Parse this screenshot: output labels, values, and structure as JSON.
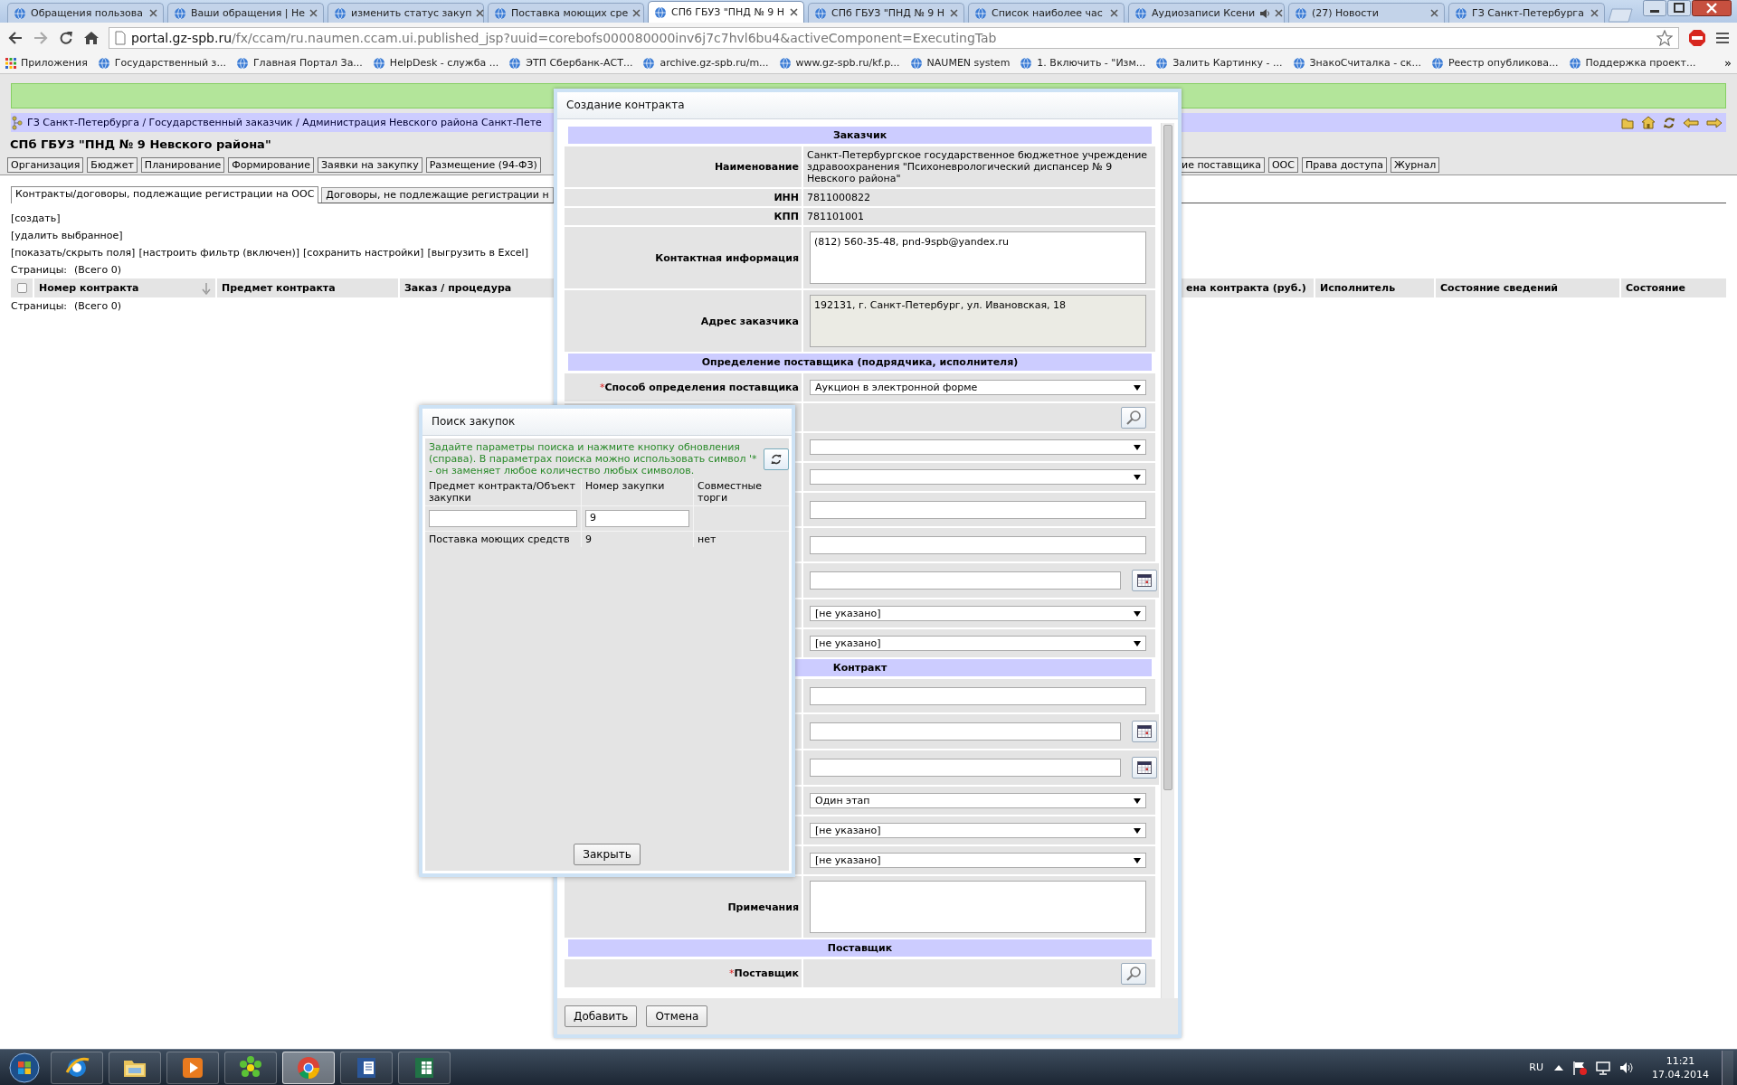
{
  "browser": {
    "tabs": [
      {
        "title": "Обращения пользова",
        "selected": false,
        "audio": false
      },
      {
        "title": "Ваши обращения | Не",
        "selected": false,
        "audio": false
      },
      {
        "title": "изменить статус закуп",
        "selected": false,
        "audio": false
      },
      {
        "title": "Поставка моющих сре",
        "selected": false,
        "audio": false
      },
      {
        "title": "СПб ГБУЗ \"ПНД № 9 Н",
        "selected": true,
        "audio": false
      },
      {
        "title": "СПб ГБУЗ \"ПНД № 9 Н",
        "selected": false,
        "audio": false
      },
      {
        "title": "Список наиболее час",
        "selected": false,
        "audio": false
      },
      {
        "title": "Аудиозаписи Ксени",
        "selected": false,
        "audio": true
      },
      {
        "title": "(27) Новости",
        "selected": false,
        "audio": false
      },
      {
        "title": "ГЗ Санкт-Петербурга",
        "selected": false,
        "audio": false
      }
    ],
    "address": {
      "host": "portal.gz-spb.ru",
      "path": "/fx/ccam/ru.naumen.ccam.ui.published_jsp?uuid=corebofs000080000inv6j7c7hvl6bu4&activeComponent=ExecutingTab"
    },
    "apps_label": "Приложения",
    "bookmarks": [
      "Государственный з...",
      "Главная Портал За...",
      "HelpDesk - служба ...",
      "ЭТП Сбербанк-АСТ...",
      "archive.gz-spb.ru/m...",
      "www.gz-spb.ru/kf.p...",
      "NAUMEN system",
      "1. Включить - \"Изм...",
      "Залить Картинку - ...",
      "ЗнакоСчиталка - ск...",
      "Реестр опубликова...",
      "Поддержка проект..."
    ],
    "bookmarks_more": "»"
  },
  "page": {
    "breadcrumb": "ГЗ Санкт-Петербурга / Государственный заказчик / Администрация Невского района Санкт-Пете",
    "title": "СПб ГБУЗ \"ПНД № 9 Невского района\"",
    "nav_left": [
      "Организация",
      "Бюджет",
      "Планирование",
      "Формирование",
      "Заявки на закупку",
      "Размещение (94-ФЗ)"
    ],
    "nav_right": [
      "ие поставщика",
      "ООС",
      "Права доступа",
      "Журнал"
    ],
    "subtabs": [
      {
        "label": "Контракты/договоры, подлежащие регистрации на ООС",
        "selected": true
      },
      {
        "label": "Договоры, не подлежащие регистрации н",
        "selected": false
      }
    ],
    "actions": [
      [
        "[создать]"
      ],
      [
        "[удалить выбранное]"
      ],
      [
        "[показать/скрыть поля]",
        "[настроить фильтр (включен)]",
        "[сохранить настройки]",
        "[выгрузить в Excel]"
      ]
    ],
    "pager_top": {
      "label": "Страницы:",
      "total": "(Всего 0)"
    },
    "select_all_checked": false,
    "columns_left": [
      "Номер контракта",
      "Предмет контракта",
      "Заказ / процедура"
    ],
    "columns_right": [
      "ена контракта (руб.)",
      "Исполнитель",
      "Состояние сведений",
      "Состояние"
    ],
    "pager_bottom": {
      "label": "Страницы:",
      "total": "(Всего 0)"
    }
  },
  "contract_dialog": {
    "title": "Создание контракта",
    "required_mark": "*",
    "sections": [
      {
        "heading": "Заказчик",
        "rows": [
          {
            "kind": "text",
            "label": "Наименование",
            "required": false,
            "value": "Санкт-Петербургское государственное бюджетное учреждение здравоохранения \"Психоневрологический диспансер № 9 Невского района\""
          },
          {
            "kind": "text",
            "label": "ИНН",
            "required": false,
            "value": "7811000822"
          },
          {
            "kind": "text",
            "label": "КПП",
            "required": false,
            "value": "781101001"
          },
          {
            "kind": "textarea",
            "label": "Контактная информация",
            "required": false,
            "disabled": false,
            "value": "(812) 560-35-48, pnd-9spb@yandex.ru"
          },
          {
            "kind": "textarea",
            "label": "Адрес заказчика",
            "required": false,
            "disabled": true,
            "value": "192131, г. Санкт-Петербург, ул. Ивановская, 18"
          }
        ]
      },
      {
        "heading": "Определение поставщика (подрядчика, исполнителя)",
        "rows": [
          {
            "kind": "select",
            "label": "Способ определения поставщика",
            "required": true,
            "value": "Аукцион в электронной форме"
          },
          {
            "kind": "lookup"
          },
          {
            "kind": "select"
          },
          {
            "kind": "select"
          },
          {
            "kind": "input"
          },
          {
            "kind": "input"
          },
          {
            "kind": "date"
          },
          {
            "kind": "select",
            "value": "[не указано]"
          },
          {
            "kind": "select",
            "value": "[не указано]"
          }
        ]
      },
      {
        "heading": "Контракт",
        "rows": [
          {
            "kind": "input"
          },
          {
            "kind": "date"
          },
          {
            "kind": "date"
          },
          {
            "kind": "select",
            "value": "Один этап"
          },
          {
            "kind": "select",
            "value": "[не указано]"
          },
          {
            "kind": "select",
            "value": "[не указано]"
          },
          {
            "kind": "textarea",
            "label": "Примечания",
            "required": false,
            "disabled": false
          }
        ]
      },
      {
        "heading": "Поставщик",
        "rows": [
          {
            "kind": "lookup",
            "label": "Поставщик",
            "required": true
          }
        ]
      }
    ],
    "buttons": [
      "Добавить",
      "Отмена"
    ]
  },
  "search_dialog": {
    "title": "Поиск закупок",
    "hint": "Задайте параметры поиска и нажмите кнопку обновления (справа). В параметрах поиска можно использовать символ '* - он заменяет любое количество любых символов.",
    "columns": [
      "Предмет контракта/Объект закупки",
      "Номер закупки",
      "Совместные торги"
    ],
    "filters": [
      {
        "kind": "input"
      },
      {
        "kind": "input",
        "value": "9"
      },
      {
        "kind": "none"
      }
    ],
    "rows": [
      [
        "Поставка моющих средств",
        "9",
        "нет"
      ]
    ],
    "close": "Закрыть"
  },
  "taskbar": {
    "apps": [
      {
        "selected": false
      },
      {
        "selected": false
      },
      {
        "selected": false
      },
      {
        "selected": false
      },
      {
        "selected": true
      },
      {
        "selected": false
      },
      {
        "selected": false
      }
    ],
    "language": "RU",
    "time": "11:21",
    "date": "17.04.2014"
  }
}
